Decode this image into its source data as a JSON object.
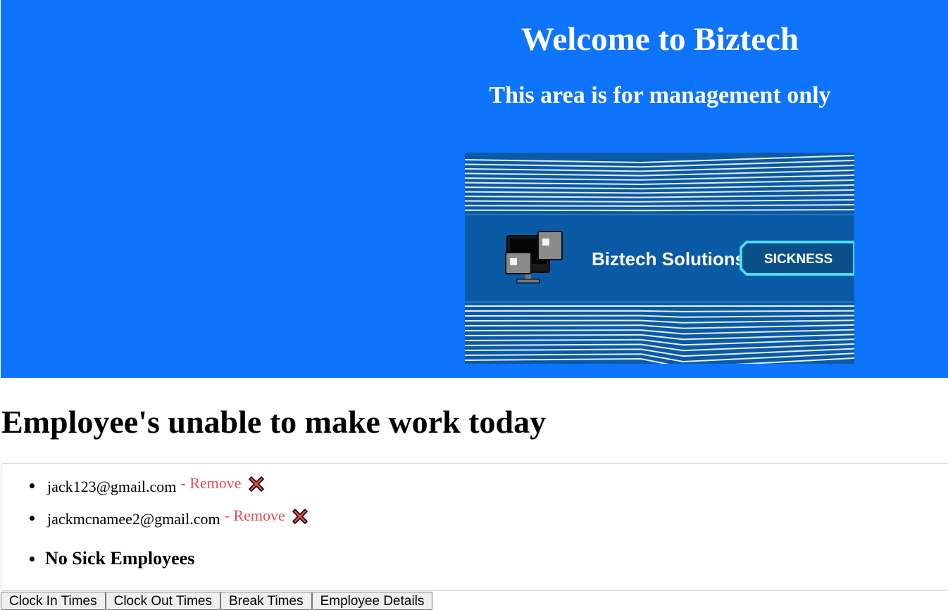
{
  "header": {
    "title": "Welcome to Biztech",
    "subtitle": "This area is for management only"
  },
  "banner": {
    "brand": "Biztech Solutions",
    "tag": "SICKNESS",
    "background_color": "#0a5aa6",
    "accent_color": "#2fd3f2"
  },
  "main": {
    "heading": "Employee's unable to make work today",
    "employees": [
      {
        "email": "jack123@gmail.com",
        "remove_label": "- Remove"
      },
      {
        "email": "jackmcnamee2@gmail.com",
        "remove_label": "- Remove"
      }
    ],
    "empty_message": "No Sick Employees"
  },
  "tabs": [
    {
      "label": "Clock In Times"
    },
    {
      "label": "Clock Out Times"
    },
    {
      "label": "Break Times"
    },
    {
      "label": "Employee Details"
    }
  ],
  "colors": {
    "hero_background": "#0d74fb",
    "remove_text": "#d9534f",
    "remove_icon": "#e74c3c"
  }
}
